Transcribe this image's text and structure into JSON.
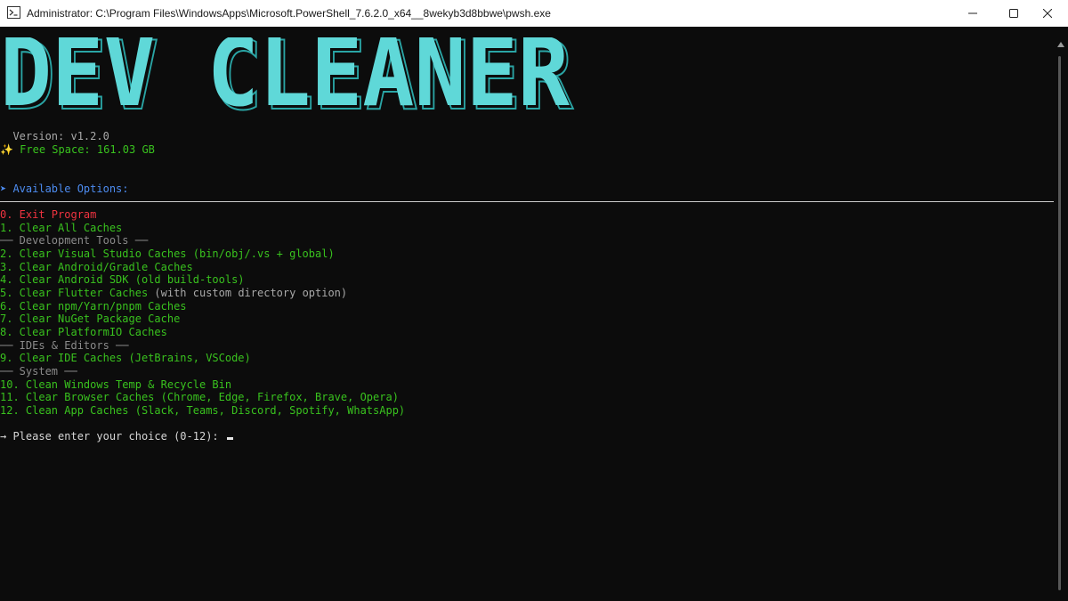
{
  "window": {
    "title": "Administrator: C:\\Program Files\\WindowsApps\\Microsoft.PowerShell_7.6.2.0_x64__8wekyb3d8bbwe\\pwsh.exe"
  },
  "banner": {
    "text": "DEV CLEANER",
    "color": "#5fd8d8",
    "shadow_color": "#2aa5a5"
  },
  "info": {
    "version": "  Version: v1.2.0",
    "free_space_icon": "✨",
    "free_space": " Free Space: 161.03 GB"
  },
  "options_header": {
    "arrow": "➤",
    "label": " Available Options:"
  },
  "menu": [
    {
      "text": "0. Exit Program",
      "style": "red"
    },
    {
      "text": "1. Clear All Caches",
      "style": "green"
    },
    {
      "text": "── Development Tools ──",
      "style": "dim"
    },
    {
      "text": "2. Clear Visual Studio Caches (bin/obj/.vs + global)",
      "style": "green"
    },
    {
      "text": "3. Clear Android/Gradle Caches",
      "style": "green"
    },
    {
      "text": "4. Clear Android SDK (old build-tools)",
      "style": "green"
    },
    {
      "text": "5. Clear Flutter Caches",
      "style": "green",
      "suffix": " (with custom directory option)"
    },
    {
      "text": "6. Clear npm/Yarn/pnpm Caches",
      "style": "green"
    },
    {
      "text": "7. Clear NuGet Package Cache",
      "style": "green"
    },
    {
      "text": "8. Clear PlatformIO Caches",
      "style": "green"
    },
    {
      "text": "── IDEs & Editors ──",
      "style": "dim"
    },
    {
      "text": "9. Clear IDE Caches (JetBrains, VSCode)",
      "style": "green"
    },
    {
      "text": "── System ──",
      "style": "dim"
    },
    {
      "text": "10. Clean Windows Temp & Recycle Bin",
      "style": "green"
    },
    {
      "text": "11. Clear Browser Caches (Chrome, Edge, Firefox, Brave, Opera)",
      "style": "green"
    },
    {
      "text": "12. Clean App Caches (Slack, Teams, Discord, Spotify, WhatsApp)",
      "style": "green"
    }
  ],
  "prompt": {
    "text": "→ Please enter your choice (0-12): "
  }
}
